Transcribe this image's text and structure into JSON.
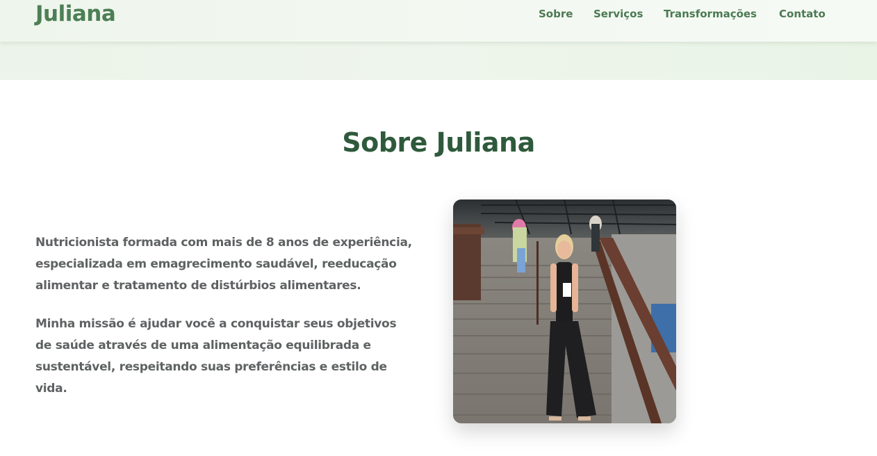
{
  "header": {
    "logo": "Juliana",
    "nav": [
      {
        "label": "Sobre"
      },
      {
        "label": "Serviços"
      },
      {
        "label": "Transformações"
      },
      {
        "label": "Contato"
      }
    ]
  },
  "about": {
    "title": "Sobre Juliana",
    "paragraphs": [
      "Nutricionista formada com mais de 8 anos de experiência, especializada em emagrecimento saudável, reeducação alimentar e tratamento de distúrbios alimentares.",
      "Minha missão é ajudar você a conquistar seus objetivos de saúde através de uma alimentação equilibrada e sustentável, respeitando suas preferências e estilo de vida."
    ]
  },
  "colors": {
    "brand_green": "#4c7f55",
    "title_green": "#2e5a3b",
    "body_text": "#5f6263"
  }
}
